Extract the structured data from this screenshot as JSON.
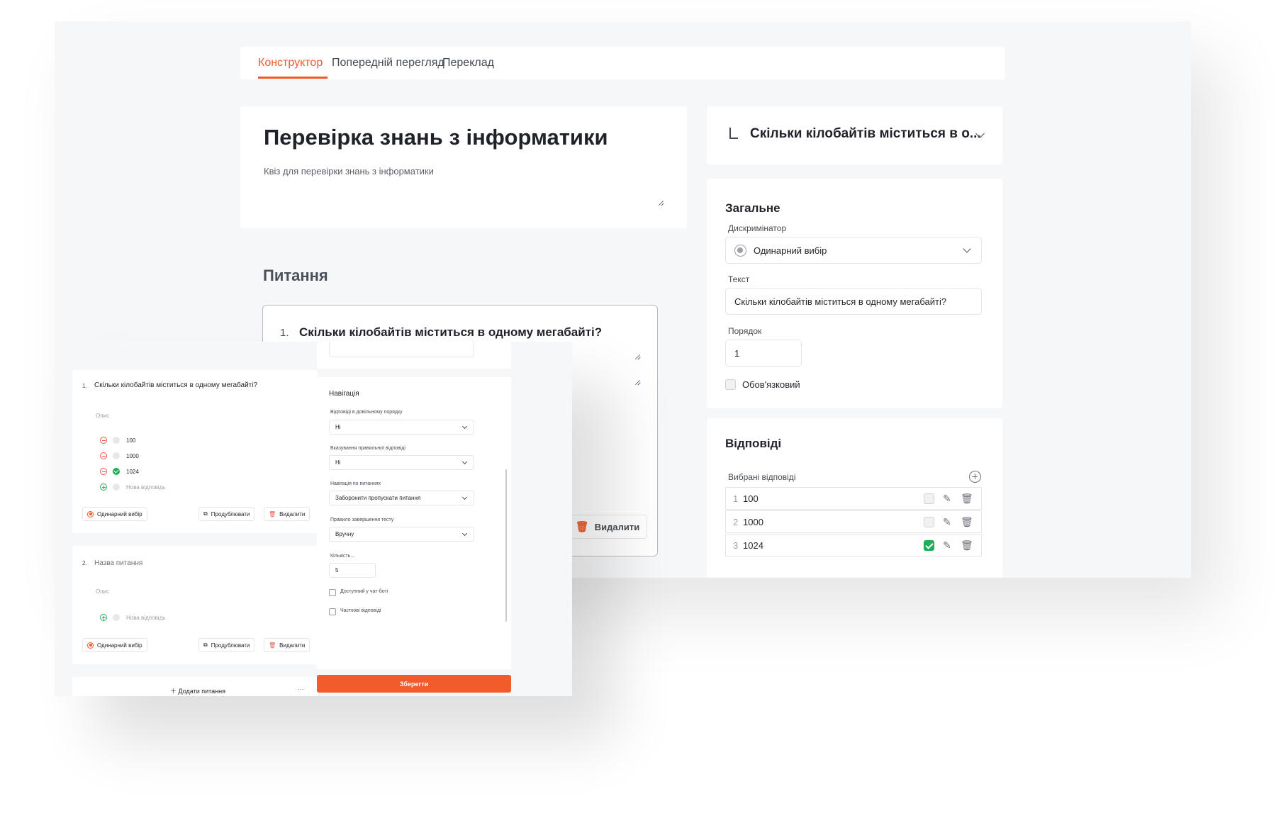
{
  "tabs": [
    {
      "label": "Конструктор",
      "active": true
    },
    {
      "label": "Попередній перегляд",
      "active": false
    },
    {
      "label": "Переклад",
      "active": false
    }
  ],
  "quiz": {
    "title": "Перевірка знань з інформатики",
    "description": "Квіз для перевірки знань з інформатики"
  },
  "questions_section": {
    "title": "Питання",
    "question": {
      "number": "1.",
      "text": "Скільки кілобайтів міститься в одному мегабайті?"
    },
    "delete_label": "Видалити"
  },
  "right_panel": {
    "header_title": "Скільки кілобайтів міститься в о...",
    "general": {
      "title": "Загальне",
      "discriminator_label": "Дискримінатор",
      "discriminator_value": "Одинарний вибір",
      "text_label": "Текст",
      "text_value": "Скільки кілобайтів міститься в одному мегабайті?",
      "order_label": "Порядок",
      "order_value": "1",
      "required_label": "Обов'язковий"
    },
    "answers": {
      "title": "Відповіді",
      "selected_label": "Вибрані відповіді",
      "items": [
        {
          "num": "1",
          "value": "100",
          "correct": false
        },
        {
          "num": "2",
          "value": "1000",
          "correct": false
        },
        {
          "num": "3",
          "value": "1024",
          "correct": true
        }
      ]
    }
  },
  "overlay": {
    "q1": {
      "number": "1.",
      "text": "Скільки кілобайтів міститься в одному мегабайті?",
      "desc_placeholder": "Опис",
      "answers": [
        "100",
        "1000",
        "1024"
      ],
      "new_answer": "Нова відповідь",
      "type_label": "Одинарний вибір",
      "duplicate_label": "Продублювати",
      "delete_label": "Видалити"
    },
    "q2": {
      "number": "2.",
      "title_placeholder": "Назва питання",
      "desc_placeholder": "Опис",
      "new_answer": "Нова відповідь",
      "type_label": "Одинарний вибір",
      "duplicate_label": "Продублювати",
      "delete_label": "Видалити"
    },
    "add_question_label": "Додати питання",
    "more_label": "···",
    "navigation": {
      "title": "Навігація",
      "fields": [
        {
          "label": "Відповіді в довільному порядку",
          "value": "Ні"
        },
        {
          "label": "Вказування правильної відповіді",
          "value": "Ні"
        },
        {
          "label": "Навігація по питаннях",
          "value": "Заборонити пропускати питання"
        },
        {
          "label": "Правило завершення тесту",
          "value": "Вручну"
        }
      ],
      "count_label": "Кількість...",
      "count_value": "5",
      "chatbot_label": "Доступний у чат-боті",
      "partial_label": "Часткові відповіді"
    },
    "save_label": "Зберегти"
  }
}
